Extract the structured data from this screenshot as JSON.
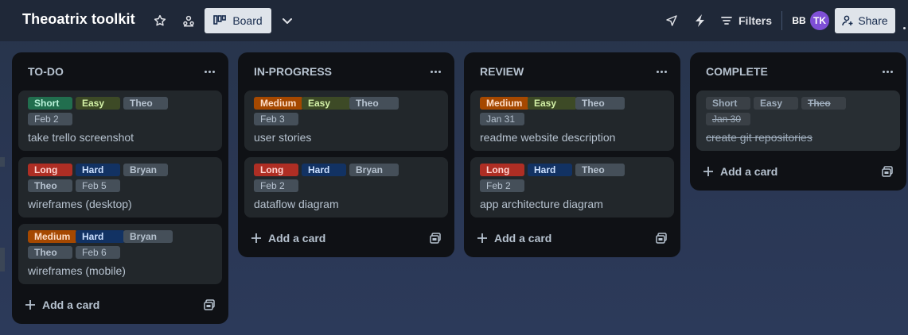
{
  "header": {
    "board_title": "Theoatrix toolkit",
    "view_label": "Board",
    "filters_label": "Filters",
    "share_label": "Share",
    "avatars": [
      "BB",
      "TK"
    ]
  },
  "colors": {
    "short": "#216e4e",
    "long": "#ae2e24",
    "medium": "#a54800",
    "easy": "#3d4a26",
    "hard": "#123263",
    "tag": "#454f59"
  },
  "lists": [
    {
      "title": "TO-DO",
      "add_label": "Add a card",
      "cards": [
        {
          "labels": [
            "Short",
            "Easy",
            "Theo"
          ],
          "date": "Feb 2",
          "title": "take trello screenshot"
        },
        {
          "labels": [
            "Long",
            "Hard",
            "Bryan",
            "Theo"
          ],
          "date": "Feb 5",
          "title": "wireframes (desktop)"
        },
        {
          "labels": [
            "Medium",
            "Hard",
            "Bryan",
            "Theo"
          ],
          "date": "Feb 6",
          "title": "wireframes (mobile)"
        }
      ]
    },
    {
      "title": "IN-PROGRESS",
      "add_label": "Add a card",
      "cards": [
        {
          "labels": [
            "Medium",
            "Easy",
            "Theo"
          ],
          "date": "Feb 3",
          "title": "user stories"
        },
        {
          "labels": [
            "Long",
            "Hard",
            "Bryan"
          ],
          "date": "Feb 2",
          "title": "dataflow diagram"
        }
      ]
    },
    {
      "title": "REVIEW",
      "add_label": "Add a card",
      "cards": [
        {
          "labels": [
            "Medium",
            "Easy",
            "Theo"
          ],
          "date": "Jan 31",
          "title": "readme website description"
        },
        {
          "labels": [
            "Long",
            "Hard",
            "Theo"
          ],
          "date": "Feb 2",
          "title": "app architecture diagram"
        }
      ]
    },
    {
      "title": "COMPLETE",
      "add_label": "Add a card",
      "cards": [
        {
          "labels": [
            "Short",
            "Easy",
            "Theo"
          ],
          "date": "Jan 30",
          "title": "create git repositories"
        }
      ]
    }
  ]
}
